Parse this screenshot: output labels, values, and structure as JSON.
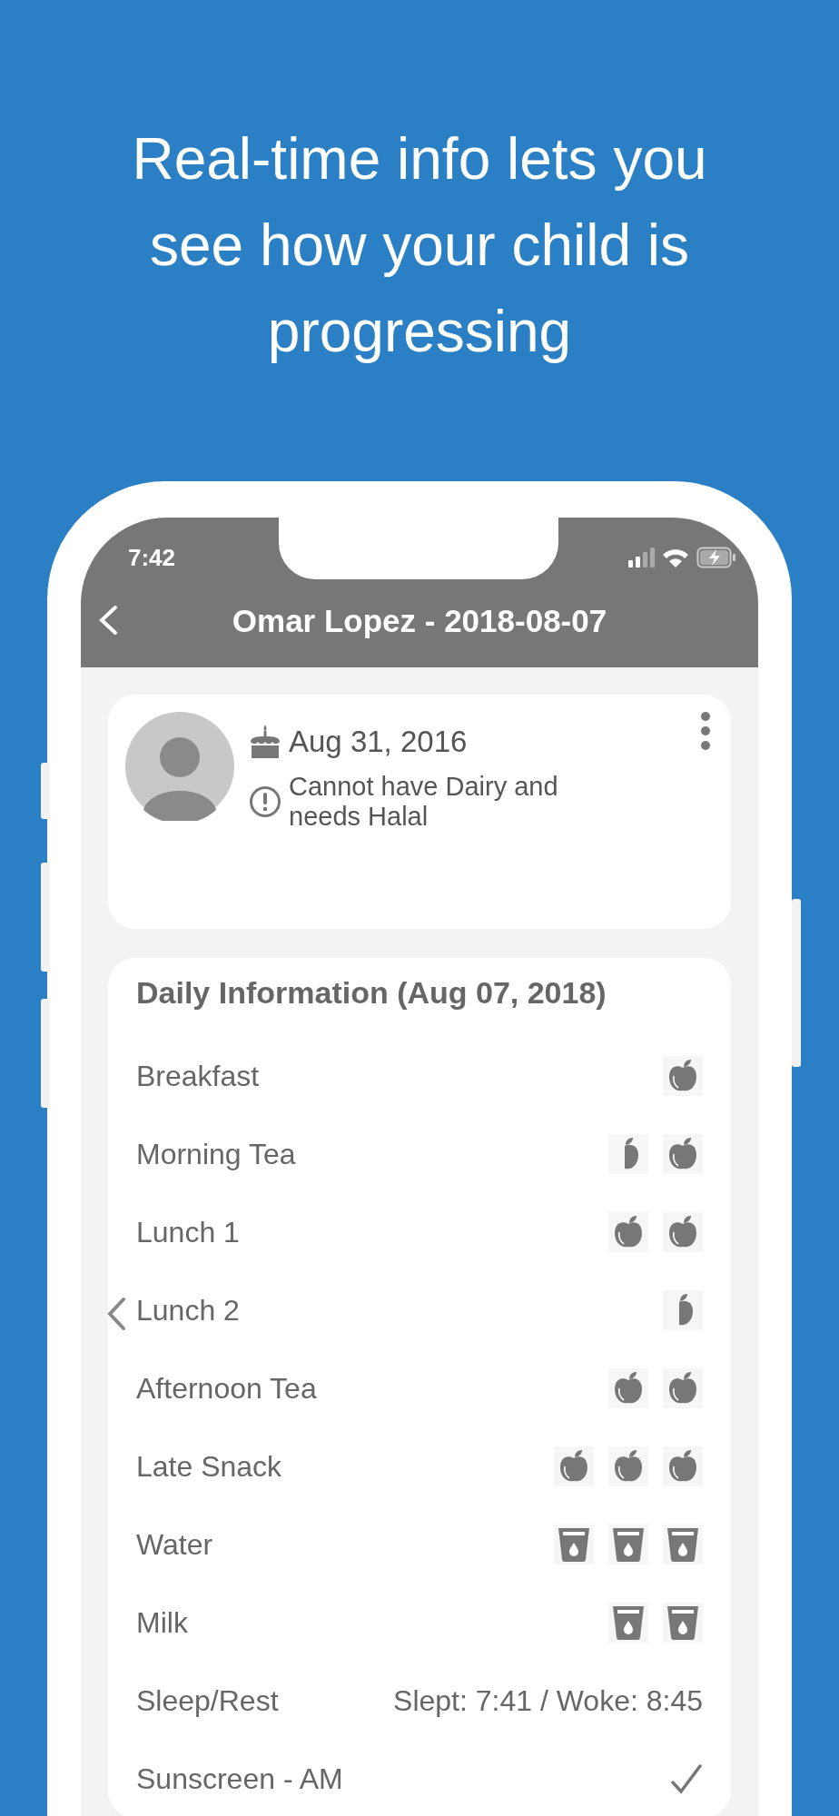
{
  "headline": "Real-time info lets you see how your child is progressing",
  "status_bar": {
    "time": "7:42"
  },
  "header": {
    "title": "Omar Lopez - 2018-08-07"
  },
  "profile": {
    "birthday": "Aug 31, 2016",
    "note": "Cannot have Dairy and needs Halal"
  },
  "daily": {
    "title": "Daily Information (Aug 07, 2018)",
    "rows": [
      {
        "label": "Breakfast",
        "kind": "food",
        "servings": [
          {
            "half": false
          }
        ]
      },
      {
        "label": "Morning Tea",
        "kind": "food",
        "servings": [
          {
            "half": true
          },
          {
            "half": false
          }
        ]
      },
      {
        "label": "Lunch 1",
        "kind": "food",
        "servings": [
          {
            "half": false
          },
          {
            "half": false
          }
        ]
      },
      {
        "label": "Lunch 2",
        "kind": "food",
        "servings": [
          {
            "half": true
          }
        ]
      },
      {
        "label": "Afternoon Tea",
        "kind": "food",
        "servings": [
          {
            "half": false
          },
          {
            "half": false
          }
        ]
      },
      {
        "label": "Late Snack",
        "kind": "food",
        "servings": [
          {
            "half": false
          },
          {
            "half": false
          },
          {
            "half": false
          }
        ]
      },
      {
        "label": "Water",
        "kind": "drink",
        "servings": [
          {
            "half": false
          },
          {
            "half": false
          },
          {
            "half": false
          }
        ]
      },
      {
        "label": "Milk",
        "kind": "drink",
        "servings": [
          {
            "half": false
          },
          {
            "half": false
          }
        ]
      },
      {
        "label": "Sleep/Rest",
        "kind": "text",
        "value": "Slept: 7:41 / Woke: 8:45"
      },
      {
        "label": "Sunscreen - AM",
        "kind": "check",
        "checked": true
      }
    ]
  }
}
